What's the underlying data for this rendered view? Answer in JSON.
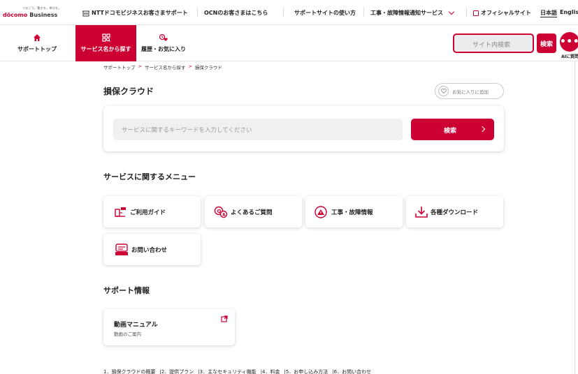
{
  "brand": {
    "tagline": "つなごう。驚きを。幸せを。",
    "name_main": "döcomo",
    "name_sub": "Business"
  },
  "topbar": {
    "items": [
      {
        "label": "NTTドコモビジネスお客さまサポート"
      },
      {
        "label": "OCNのお客さまはこちら"
      },
      {
        "label": "サポートサイトの使い方"
      },
      {
        "label": "工事・故障情報通知サービス"
      },
      {
        "label": "オフィシャルサイト"
      },
      {
        "label": "日本語"
      },
      {
        "label": "English"
      }
    ]
  },
  "nav": {
    "tabs": [
      {
        "label": "サポートトップ"
      },
      {
        "label": "サービス名から探す"
      },
      {
        "label": "履歴・お気に入り"
      }
    ],
    "search_placeholder": "サイト内検索",
    "search_button": "検索",
    "ai_button": "•••",
    "ai_label": "AIに質問"
  },
  "breadcrumb": [
    "サポートトップ",
    "サービス名から探す",
    "損保クラウド"
  ],
  "breadcrumb_sep": ">",
  "page": {
    "title": "損保クラウド",
    "favorite_label": "お気に入りに追加",
    "search_placeholder": "サービスに関するキーワードを入力してください",
    "search_button": "検索"
  },
  "menu": {
    "title": "サービスに関するメニュー",
    "items": [
      {
        "label": "ご利用ガイド",
        "icon": "guide-icon"
      },
      {
        "label": "よくあるご質問",
        "icon": "faq-icon"
      },
      {
        "label": "工事・故障情報",
        "icon": "maintenance-icon"
      },
      {
        "label": "各種ダウンロード",
        "icon": "download-icon"
      },
      {
        "label": "お問い合わせ",
        "icon": "contact-icon"
      }
    ]
  },
  "support": {
    "title": "サポート情報",
    "card_title": "動画マニュアル",
    "card_sub": "動画のご案内"
  },
  "footer_links": [
    "1．損保クラウドの概要",
    "|2．提供プラン",
    "|3．主なセキュリティ機能",
    "|4．料金",
    "|5．お申し込み方法",
    "|6．お問い合わせ"
  ],
  "colors": {
    "accent": "#cc0033"
  }
}
